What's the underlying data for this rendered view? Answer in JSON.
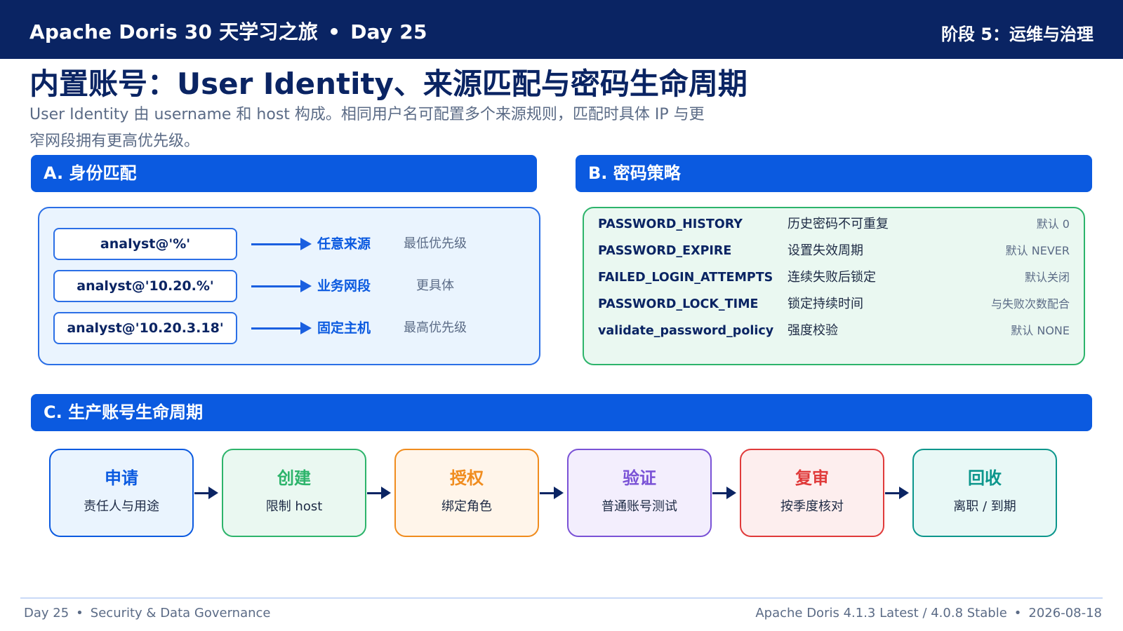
{
  "header": {
    "course": "Apache Doris 30 天学习之旅",
    "separator": "•",
    "day": "Day 25",
    "stage": "阶段 5：运维与治理"
  },
  "title": "内置账号：User Identity、来源匹配与密码生命周期",
  "subtitle": "User Identity 由 username 和 host 构成。相同用户名可配置多个来源规则，匹配时具体 IP 与更窄网段拥有更高优先级。",
  "section_a": {
    "heading": "A. 身份匹配",
    "rows": [
      {
        "identity": "analyst@'%'",
        "source": "任意来源",
        "priority": "最低优先级"
      },
      {
        "identity": "analyst@'10.20.%'",
        "source": "业务网段",
        "priority": "更具体"
      },
      {
        "identity": "analyst@'10.20.3.18'",
        "source": "固定主机",
        "priority": "最高优先级"
      }
    ]
  },
  "section_b": {
    "heading": "B. 密码策略",
    "rows": [
      {
        "key": "PASSWORD_HISTORY",
        "desc": "历史密码不可重复",
        "default": "默认 0"
      },
      {
        "key": "PASSWORD_EXPIRE",
        "desc": "设置失效周期",
        "default": "默认 NEVER"
      },
      {
        "key": "FAILED_LOGIN_ATTEMPTS",
        "desc": "连续失败后锁定",
        "default": "默认关闭"
      },
      {
        "key": "PASSWORD_LOCK_TIME",
        "desc": "锁定持续时间",
        "default": "与失败次数配合"
      },
      {
        "key": "validate_password_policy",
        "desc": "强度校验",
        "default": "默认 NONE"
      }
    ]
  },
  "section_c": {
    "heading": "C. 生产账号生命周期",
    "steps": [
      {
        "name": "申请",
        "desc": "责任人与用途",
        "color": "#0b5ae0",
        "bg": "#eaf4fe"
      },
      {
        "name": "创建",
        "desc": "限制 host",
        "color": "#2db46b",
        "bg": "#eaf8f1"
      },
      {
        "name": "授权",
        "desc": "绑定角色",
        "color": "#f08c1e",
        "bg": "#fff5ea"
      },
      {
        "name": "验证",
        "desc": "普通账号测试",
        "color": "#7a52d6",
        "bg": "#f3eefd"
      },
      {
        "name": "复审",
        "desc": "按季度核对",
        "color": "#e03a3a",
        "bg": "#fdeeee"
      },
      {
        "name": "回收",
        "desc": "离职 / 到期",
        "color": "#0c968c",
        "bg": "#e8f8f6"
      }
    ]
  },
  "footer": {
    "left_day": "Day 25",
    "left_topic": "Security & Data Governance",
    "right_version": "Apache Doris 4.1.3 Latest / 4.0.8 Stable",
    "right_date": "2026-08-18",
    "separator": "•"
  },
  "colors": {
    "header_bg": "#0a2463",
    "section_blue": "#0b5ae0",
    "panel_a_border": "#2b6fe6",
    "panel_b_border": "#2db46b"
  }
}
